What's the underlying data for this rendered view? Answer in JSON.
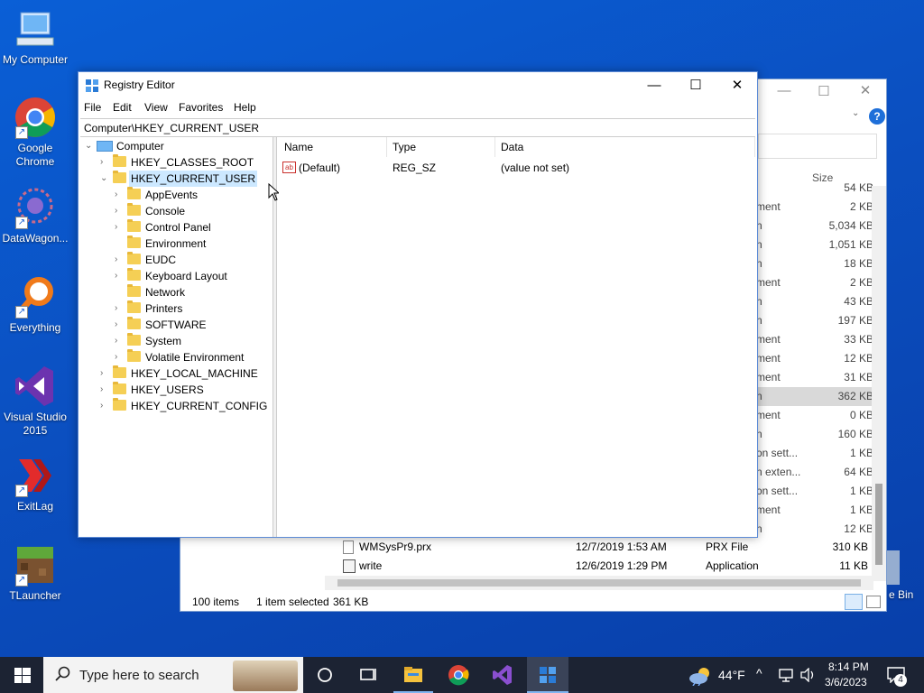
{
  "desktop": {
    "icons": [
      {
        "label": "My Computer",
        "icon": "computer-icon"
      },
      {
        "label": "Google Chrome",
        "icon": "chrome-icon"
      },
      {
        "label": "DataWagon...",
        "icon": "datawagon-icon"
      },
      {
        "label": "Everything",
        "icon": "search-magnifier-icon"
      },
      {
        "label": "Visual Studio 2015",
        "icon": "visual-studio-icon"
      },
      {
        "label": "ExitLag",
        "icon": "exitlag-icon"
      },
      {
        "label": "TLauncher",
        "icon": "tlauncher-icon"
      }
    ],
    "recycle_bin_label": "e Bin"
  },
  "explorer": {
    "size_header": "Size",
    "rows": [
      {
        "type": "",
        "size": "54 KB"
      },
      {
        "type": "ment",
        "size": "2 KB"
      },
      {
        "type": "n",
        "size": "5,034 KB"
      },
      {
        "type": "n",
        "size": "1,051 KB"
      },
      {
        "type": "n",
        "size": "18 KB"
      },
      {
        "type": "ment",
        "size": "2 KB"
      },
      {
        "type": "n",
        "size": "43 KB"
      },
      {
        "type": "n",
        "size": "197 KB"
      },
      {
        "type": "ment",
        "size": "33 KB"
      },
      {
        "type": "ment",
        "size": "12 KB"
      },
      {
        "type": "ment",
        "size": "31 KB"
      },
      {
        "type": "n",
        "size": "362 KB"
      },
      {
        "type": "ment",
        "size": "0 KB"
      },
      {
        "type": "n",
        "size": "160 KB"
      },
      {
        "type": "on sett...",
        "size": "1 KB"
      },
      {
        "type": "n exten...",
        "size": "64 KB"
      },
      {
        "type": "on sett...",
        "size": "1 KB"
      },
      {
        "type": "ment",
        "size": "1 KB"
      },
      {
        "type": "n",
        "size": "12 KB"
      }
    ],
    "files": [
      {
        "name": "WMSysPr9.prx",
        "date": "12/7/2019 1:53 AM",
        "type": "PRX File",
        "size": "310 KB"
      },
      {
        "name": "write",
        "date": "12/6/2019 1:29 PM",
        "type": "Application",
        "size": "11 KB"
      }
    ],
    "status_items": "100 items",
    "status_selected": "1 item selected",
    "status_size": "361 KB"
  },
  "regedit": {
    "title": "Registry Editor",
    "menu": [
      "File",
      "Edit",
      "View",
      "Favorites",
      "Help"
    ],
    "address": "Computer\\HKEY_CURRENT_USER",
    "tree": {
      "root": "Computer",
      "hives": [
        "HKEY_CLASSES_ROOT",
        "HKEY_CURRENT_USER",
        "HKEY_LOCAL_MACHINE",
        "HKEY_USERS",
        "HKEY_CURRENT_CONFIG"
      ],
      "hkcu_children": [
        "AppEvents",
        "Console",
        "Control Panel",
        "Environment",
        "EUDC",
        "Keyboard Layout",
        "Network",
        "Printers",
        "SOFTWARE",
        "System",
        "Volatile Environment"
      ]
    },
    "columns": [
      "Name",
      "Type",
      "Data"
    ],
    "values": [
      {
        "name": "(Default)",
        "type": "REG_SZ",
        "data": "(value not set)"
      }
    ]
  },
  "taskbar": {
    "search_placeholder": "Type here to search",
    "weather": "44°F",
    "time": "8:14 PM",
    "date": "3/6/2023",
    "notification_count": "4"
  }
}
